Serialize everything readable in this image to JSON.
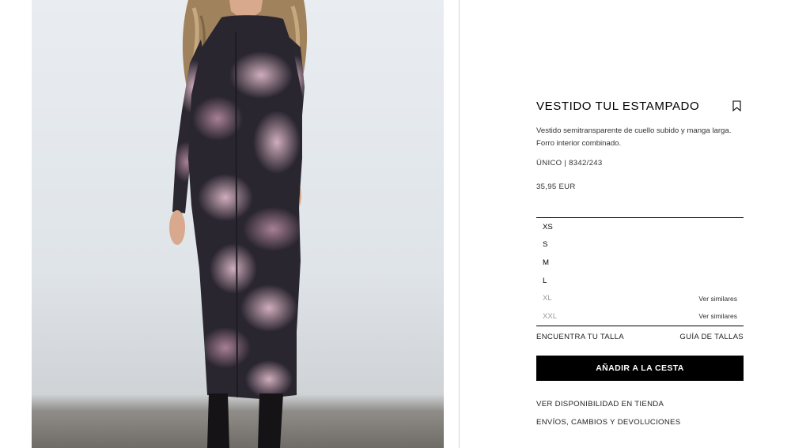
{
  "product": {
    "title": "VESTIDO TUL ESTAMPADO",
    "description": "Vestido semitransparente de cuello subido y manga larga. Forro interior combinado.",
    "reference": "ÚNICO | 8342/243",
    "price": "35,95 EUR",
    "bookmark_icon": "bookmark-icon",
    "photo_alt": "Model wearing a long black and pink tie-dye tulle dress"
  },
  "sizes": [
    {
      "label": "XS",
      "available": true,
      "note": ""
    },
    {
      "label": "S",
      "available": true,
      "note": ""
    },
    {
      "label": "M",
      "available": true,
      "note": ""
    },
    {
      "label": "L",
      "available": true,
      "note": ""
    },
    {
      "label": "XL",
      "available": false,
      "note": "Ver similares"
    },
    {
      "label": "XXL",
      "available": false,
      "note": "Ver similares"
    }
  ],
  "size_links": {
    "find_size": "ENCUENTRA TU TALLA",
    "size_guide": "GUÍA DE TALLAS"
  },
  "actions": {
    "add_to_cart": "AÑADIR A LA CESTA"
  },
  "footer_links": {
    "store_availability": "VER DISPONIBILIDAD EN TIENDA",
    "shipping_returns": "ENVÍOS, CAMBIOS Y DEVOLUCIONES"
  },
  "colors": {
    "accent": "#000000",
    "unavailable_text": "#9a9a9a",
    "dress_dark": "#2a2630",
    "dress_pink": "#c9a3b4"
  }
}
